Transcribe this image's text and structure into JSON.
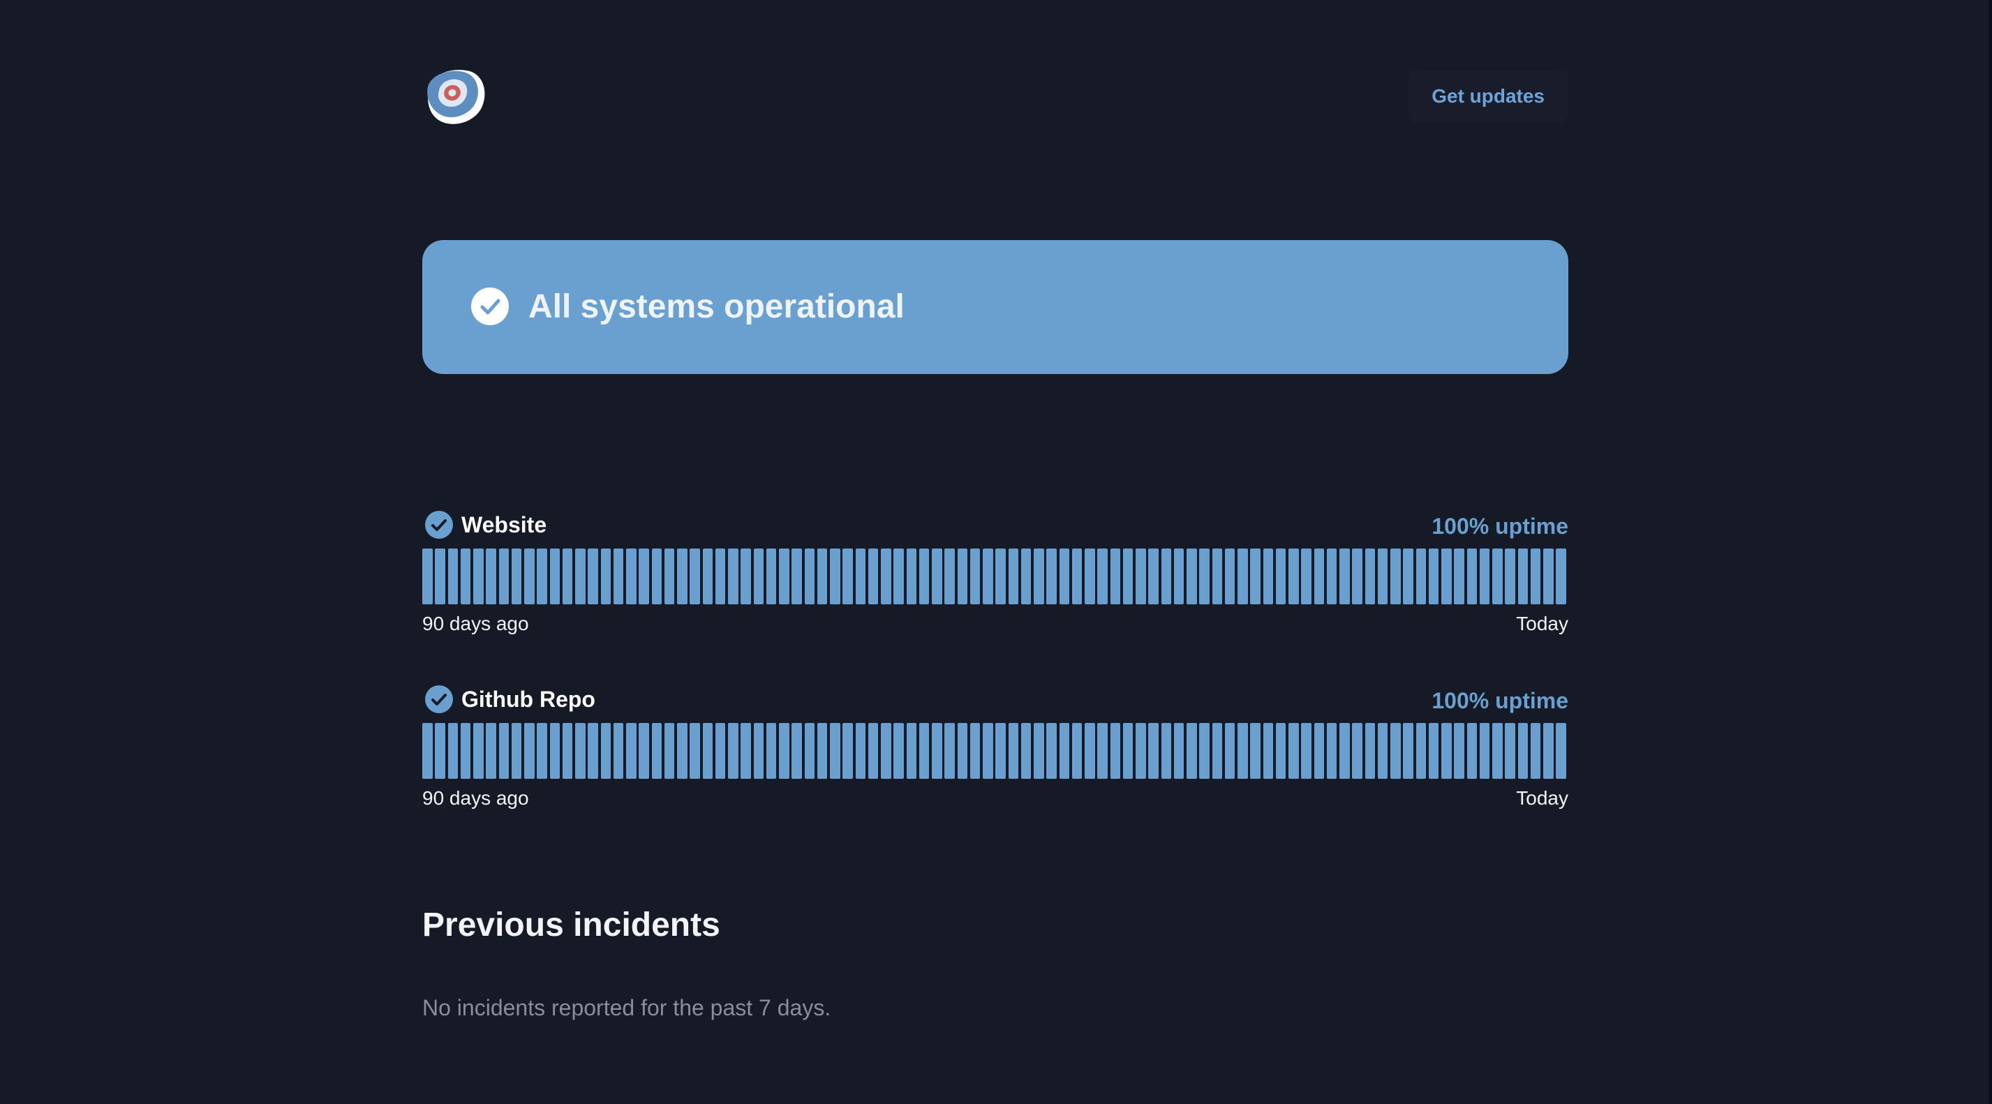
{
  "header": {
    "logo_icon": "logo-icon",
    "get_updates_label": "Get updates"
  },
  "banner": {
    "icon": "check-circle-icon",
    "text": "All systems operational",
    "color": "#6aa0cf"
  },
  "services": [
    {
      "name": "Website",
      "icon": "check-circle-icon",
      "uptime": "100% uptime",
      "range_start": "90 days ago",
      "range_end": "Today",
      "days_up": 90,
      "days_total": 90
    },
    {
      "name": "Github Repo",
      "icon": "check-circle-icon",
      "uptime": "100% uptime",
      "range_start": "90 days ago",
      "range_end": "Today",
      "days_up": 90,
      "days_total": 90
    }
  ],
  "incidents": {
    "title": "Previous incidents",
    "empty_message": "No incidents reported for the past 7 days."
  },
  "colors": {
    "background": "#161926",
    "accent": "#6aa0cf",
    "muted_text": "#8a8e99"
  }
}
